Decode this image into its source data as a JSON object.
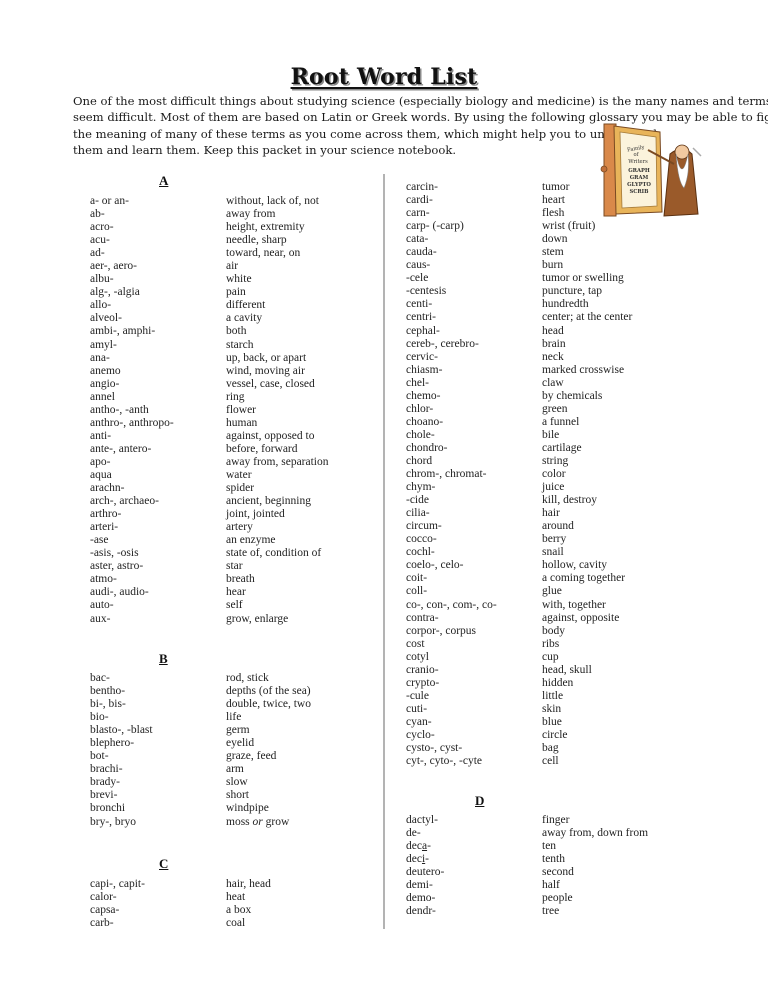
{
  "document": {
    "title": "Root Word List",
    "intro_lines": [
      "One of the most difficult things about studying science (especially biology and medicine) is the many names and terms that",
      "seem difficult.  Most of them are based on Latin or Greek words.  By using the following glossary you may be able to figure",
      "the meaning of many of these terms as you come across them, which might help you to understand",
      "them and learn them.  Keep this packet in your science notebook."
    ],
    "illustration": {
      "sign_text": [
        "Family",
        "of",
        "Writers",
        "GRAPH",
        "GRAM",
        "GLYPTO",
        "SCRIB"
      ]
    }
  },
  "sections": {
    "A": {
      "heading": "A",
      "entries": [
        {
          "root": "a- or an-",
          "meaning": "without, lack of, not"
        },
        {
          "root": "ab-",
          "meaning": "away from"
        },
        {
          "root": "acro-",
          "meaning": "height, extremity"
        },
        {
          "root": "acu-",
          "meaning": "needle, sharp"
        },
        {
          "root": "ad-",
          "meaning": "toward, near, on"
        },
        {
          "root": "aer-, aero-",
          "meaning": "air"
        },
        {
          "root": "albu-",
          "meaning": "white"
        },
        {
          "root": "alg-, -algia",
          "meaning": "pain"
        },
        {
          "root": "allo-",
          "meaning": "different"
        },
        {
          "root": "alveol-",
          "meaning": "a cavity"
        },
        {
          "root": "ambi-, amphi-",
          "meaning": "both"
        },
        {
          "root": "amyl-",
          "meaning": "starch"
        },
        {
          "root": "ana-",
          "meaning": "up, back, or apart"
        },
        {
          "root": "anemo",
          "meaning": "wind, moving air"
        },
        {
          "root": "angio-",
          "meaning": "vessel, case, closed"
        },
        {
          "root": "annel",
          "meaning": "ring"
        },
        {
          "root": "antho-, -anth",
          "meaning": "flower"
        },
        {
          "root": "anthro-, anthropo-",
          "meaning": "human"
        },
        {
          "root": "anti-",
          "meaning": "against, opposed to"
        },
        {
          "root": "ante-, antero-",
          "meaning": "before, forward"
        },
        {
          "root": "apo-",
          "meaning": "away from, separation"
        },
        {
          "root": "aqua",
          "meaning": "water"
        },
        {
          "root": "arachn-",
          "meaning": "spider"
        },
        {
          "root": "arch-, archaeo-",
          "meaning": "ancient, beginning"
        },
        {
          "root": "arthro-",
          "meaning": "joint, jointed"
        },
        {
          "root": "arteri-",
          "meaning": "artery"
        },
        {
          "root": "-ase",
          "meaning": "an enzyme"
        },
        {
          "root": "-asis, -osis",
          "meaning": "state of, condition of"
        },
        {
          "root": "aster, astro-",
          "meaning": "star"
        },
        {
          "root": "atmo-",
          "meaning": "breath"
        },
        {
          "root": "audi-, audio-",
          "meaning": "hear"
        },
        {
          "root": "auto-",
          "meaning": "self"
        },
        {
          "root": "aux-",
          "meaning": "grow, enlarge"
        }
      ]
    },
    "B": {
      "heading": "B",
      "entries": [
        {
          "root": "bac-",
          "meaning": "rod, stick"
        },
        {
          "root": "bentho-",
          "meaning": "depths (of the sea)"
        },
        {
          "root": "bi-, bis-",
          "meaning": "double, twice, two"
        },
        {
          "root": "bio-",
          "meaning": "life"
        },
        {
          "root": "blasto-, -blast",
          "meaning": "germ"
        },
        {
          "root": "blephero-",
          "meaning": "eyelid"
        },
        {
          "root": "bot-",
          "meaning": "graze, feed"
        },
        {
          "root": "brachi-",
          "meaning": "arm"
        },
        {
          "root": "brady-",
          "meaning": "slow"
        },
        {
          "root": "brevi-",
          "meaning": "short"
        },
        {
          "root": "bronchi",
          "meaning": "windpipe"
        },
        {
          "root": "bry-, bryo",
          "meaning_pre": "moss ",
          "meaning_em": "or",
          "meaning_post": " grow"
        }
      ]
    },
    "C": {
      "heading": "C",
      "entries_left": [
        {
          "root": "capi-, capit-",
          "meaning": "hair, head"
        },
        {
          "root": "calor-",
          "meaning": "heat"
        },
        {
          "root": "capsa-",
          "meaning": "a box"
        },
        {
          "root": "carb-",
          "meaning": "coal"
        }
      ],
      "entries_right": [
        {
          "root": "carcin-",
          "meaning": "tumor"
        },
        {
          "root": "cardi-",
          "meaning": "heart"
        },
        {
          "root": "carn-",
          "meaning": "flesh"
        },
        {
          "root": "carp- (-carp)",
          "meaning": "wrist (fruit)"
        },
        {
          "root": "cata-",
          "meaning": "down"
        },
        {
          "root": "cauda-",
          "meaning": "stem"
        },
        {
          "root": "caus-",
          "meaning": "burn"
        },
        {
          "root": "-cele",
          "meaning": "tumor or swelling"
        },
        {
          "root": "-centesis",
          "meaning": "puncture, tap"
        },
        {
          "root": "centi-",
          "meaning": "hundredth"
        },
        {
          "root": "centri-",
          "meaning": "center; at the center"
        },
        {
          "root": "cephal-",
          "meaning": "head"
        },
        {
          "root": "cereb-, cerebro-",
          "meaning": "brain"
        },
        {
          "root": "cervic-",
          "meaning": "neck"
        },
        {
          "root": "chiasm-",
          "meaning": "marked crosswise"
        },
        {
          "root": "chel-",
          "meaning": "claw"
        },
        {
          "root": "chemo-",
          "meaning": "by chemicals"
        },
        {
          "root": "chlor-",
          "meaning": "green"
        },
        {
          "root": "choano-",
          "meaning": "a funnel"
        },
        {
          "root": "chole-",
          "meaning": "bile"
        },
        {
          "root": "chondro-",
          "meaning": "cartilage"
        },
        {
          "root": "chord",
          "meaning": "string"
        },
        {
          "root": "chrom-, chromat-",
          "meaning": "color"
        },
        {
          "root": "chym-",
          "meaning": "juice"
        },
        {
          "root": "-cide",
          "meaning": "kill, destroy"
        },
        {
          "root": "cilia-",
          "meaning": "hair"
        },
        {
          "root": "circum-",
          "meaning": "around"
        },
        {
          "root": "cocco-",
          "meaning": "berry"
        },
        {
          "root": "cochl-",
          "meaning": "snail"
        },
        {
          "root": "coelo-, celo-",
          "meaning": "hollow, cavity"
        },
        {
          "root": "coit-",
          "meaning": "a coming together"
        },
        {
          "root": "coll-",
          "meaning": "glue"
        },
        {
          "root": "co-, con-, com-, co-",
          "meaning": "with, together"
        },
        {
          "root": "contra-",
          "meaning": "against, opposite"
        },
        {
          "root": "corpor-, corpus",
          "meaning": "body"
        },
        {
          "root": "cost",
          "meaning": "ribs"
        },
        {
          "root": "cotyl",
          "meaning": "cup"
        },
        {
          "root": "cranio-",
          "meaning": "head, skull"
        },
        {
          "root": "crypto-",
          "meaning": "hidden"
        },
        {
          "root": "-cule",
          "meaning": "little"
        },
        {
          "root": "cuti-",
          "meaning": "skin"
        },
        {
          "root": "cyan-",
          "meaning": "blue"
        },
        {
          "root": "cyclo-",
          "meaning": "circle"
        },
        {
          "root": "cysto-, cyst-",
          "meaning": "bag"
        },
        {
          "root": "cyt-, cyto-, -cyte",
          "meaning": "cell"
        }
      ]
    },
    "D": {
      "heading": "D",
      "entries": [
        {
          "root": "dactyl-",
          "meaning": "finger"
        },
        {
          "root": "de-",
          "meaning": "away from, down from"
        },
        {
          "root_pre": "dec",
          "root_u": "a",
          "root_post": "-",
          "meaning": "ten"
        },
        {
          "root_pre": "dec",
          "root_u": "i",
          "root_post": "-",
          "meaning": "tenth"
        },
        {
          "root": "deutero-",
          "meaning": "second"
        },
        {
          "root": "demi-",
          "meaning": "half"
        },
        {
          "root": "demo-",
          "meaning": "people"
        },
        {
          "root": "dendr-",
          "meaning": "tree"
        }
      ]
    }
  }
}
